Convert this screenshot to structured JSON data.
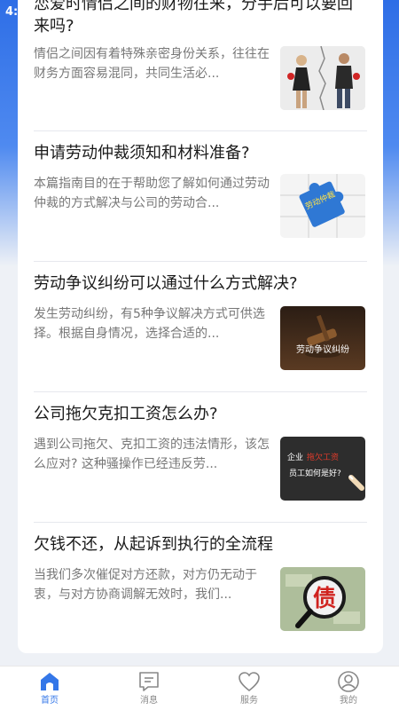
{
  "status_bar": {
    "time": "4:"
  },
  "articles": [
    {
      "title": "恋爱时情侣之间的财物往来，分手后可以要回来吗?",
      "summary": "情侣之间因有着特殊亲密身份关系，往往在财务方面容易混同，共同生活必...",
      "image": "couple-breakup-image"
    },
    {
      "title": "申请劳动仲裁须知和材料准备?",
      "summary": "本篇指南目的在于帮助您了解如何通过劳动仲裁的方式解决与公司的劳动合...",
      "image": "puzzle-arbitration-image",
      "image_text": "劳动仲裁"
    },
    {
      "title": "劳动争议纠纷可以通过什么方式解决?",
      "summary": "发生劳动纠纷，有5种争议解决方式可供选择。根据自身情况，选择合适的...",
      "image": "gavel-image",
      "image_text": "劳动争议纠纷"
    },
    {
      "title": "公司拖欠克扣工资怎么办?",
      "summary": "遇到公司拖欠、克扣工资的违法情形，该怎么应对? 这种骚操作已经违反劳...",
      "image": "chalkboard-image",
      "image_text_1": "企业",
      "image_text_2": "拖欠工资",
      "image_text_3": "员工如何是好?"
    },
    {
      "title": "欠钱不还，从起诉到执行的全流程",
      "summary": "当我们多次催促对方还款，对方仍无动于衷，与对方协商调解无效时，我们...",
      "image": "debt-magnifier-image",
      "image_text": "债"
    }
  ],
  "tabbar": [
    {
      "label": "首页",
      "icon": "home-icon",
      "active": true
    },
    {
      "label": "消息",
      "icon": "message-icon",
      "active": false
    },
    {
      "label": "服务",
      "icon": "heart-icon",
      "active": false
    },
    {
      "label": "我的",
      "icon": "profile-icon",
      "active": false
    }
  ],
  "colors": {
    "accent": "#3477e8",
    "header_blue": "#2e6ee6"
  }
}
